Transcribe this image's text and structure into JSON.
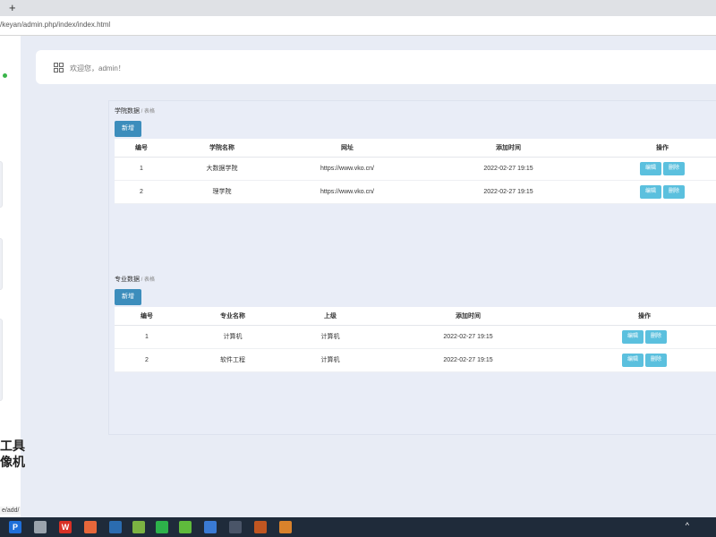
{
  "browser": {
    "new_tab_symbol": "+",
    "url": "/keyan/admin.php/index/index.html",
    "status_url": "e/add/"
  },
  "sidebar": {
    "overlay_line1": "工具",
    "overlay_line2": "像机"
  },
  "header": {
    "welcome_text": "欢迎您，admin！"
  },
  "colleges": {
    "title": "学院数据",
    "subtitle": " / 表格",
    "add_label": "新增",
    "columns": [
      "编号",
      "学院名称",
      "网址",
      "添加时间",
      "操作"
    ],
    "rows": [
      {
        "id": "1",
        "name": "大数据学院",
        "url": "https://www.vko.cn/",
        "time": "2022-02-27 19:15"
      },
      {
        "id": "2",
        "name": "理学院",
        "url": "https://www.vko.cn/",
        "time": "2022-02-27 19:15"
      }
    ],
    "edit_label": "编辑",
    "delete_label": "删除"
  },
  "majors": {
    "title": "专业数据",
    "subtitle": " / 表格",
    "add_label": "新增",
    "columns": [
      "编号",
      "专业名称",
      "上级",
      "添加时间",
      "操作"
    ],
    "rows": [
      {
        "id": "1",
        "name": "计算机",
        "parent": "计算机",
        "time": "2022-02-27 19:15"
      },
      {
        "id": "2",
        "name": "软件工程",
        "parent": "计算机",
        "time": "2022-02-27 19:15"
      }
    ],
    "edit_label": "编辑",
    "delete_label": "删除"
  },
  "taskbar": {
    "pinned_icon_label": "P",
    "wps_icon_label": "W",
    "caret": "^",
    "colors": {
      "background": "#1f2b3a",
      "accent": "#3c8dbc",
      "op_button": "#5bc0de"
    }
  }
}
